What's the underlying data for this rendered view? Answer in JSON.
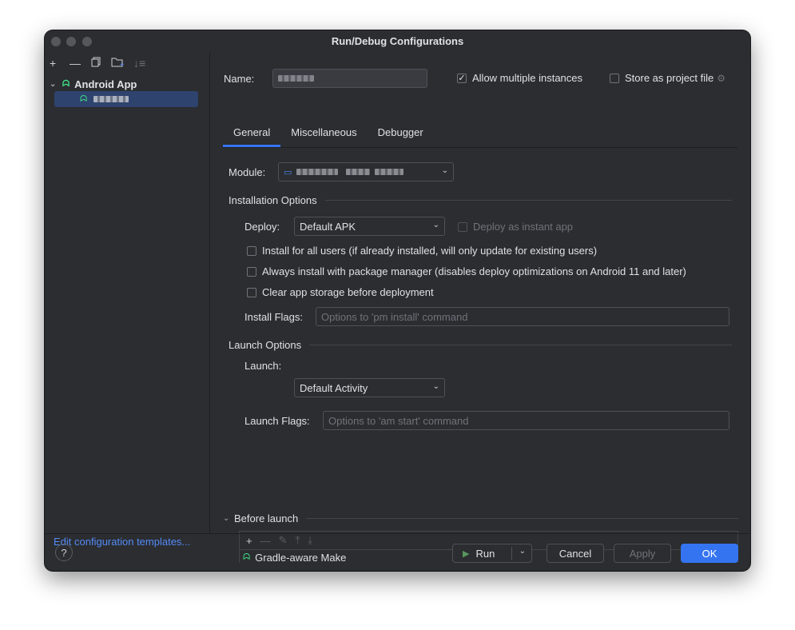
{
  "window": {
    "title": "Run/Debug Configurations"
  },
  "left": {
    "toolbar": [
      "add-icon",
      "remove-icon",
      "copy-icon",
      "new-folder-icon",
      "sort-icon"
    ],
    "tree": {
      "root_label": "Android App"
    },
    "footer_link": "Edit configuration templates..."
  },
  "header": {
    "name_label": "Name:",
    "allow_multiple_label": "Allow multiple instances",
    "allow_multiple_checked": true,
    "store_project_label": "Store as project file",
    "store_project_checked": false
  },
  "tabs": [
    "General",
    "Miscellaneous",
    "Debugger"
  ],
  "active_tab": "General",
  "general": {
    "module_label": "Module:",
    "installation_title": "Installation Options",
    "deploy_label": "Deploy:",
    "deploy_value": "Default APK",
    "instant_app_label": "Deploy as instant app",
    "install_all_users": "Install for all users (if already installed, will only update for existing users)",
    "package_manager": "Always install with package manager (disables deploy optimizations on Android 11 and later)",
    "clear_storage": "Clear app storage before deployment",
    "install_flags_label": "Install Flags:",
    "install_flags_placeholder": "Options to 'pm install' command",
    "launch_title": "Launch Options",
    "launch_label": "Launch:",
    "launch_value": "Default Activity",
    "launch_flags_label": "Launch Flags:",
    "launch_flags_placeholder": "Options to 'am start' command"
  },
  "before_launch": {
    "title": "Before launch",
    "item": "Gradle-aware Make"
  },
  "buttons": {
    "help": "?",
    "run": "Run",
    "cancel": "Cancel",
    "apply": "Apply",
    "ok": "OK"
  },
  "colors": {
    "accent": "#3574f0",
    "link": "#548af7",
    "android": "#3ddc84",
    "selection": "#2e436e"
  }
}
